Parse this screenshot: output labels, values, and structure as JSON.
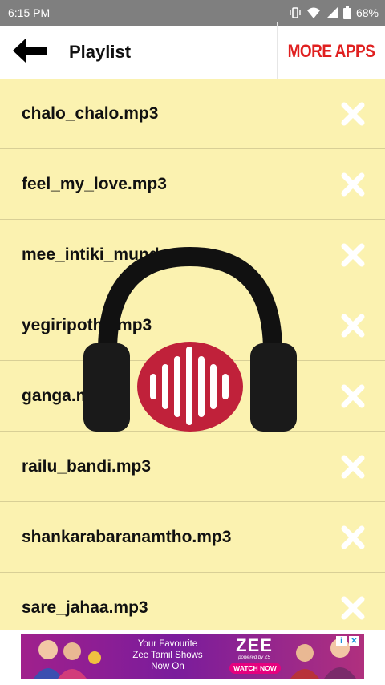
{
  "status_bar": {
    "time": "6:15 PM",
    "battery": "68%"
  },
  "app_bar": {
    "title": "Playlist",
    "more_apps_label": "MORE APPS"
  },
  "playlist": {
    "items": [
      {
        "label": "chalo_chalo.mp3"
      },
      {
        "label": "feel_my_love.mp3"
      },
      {
        "label": "mee_intiki_mundu.mp3"
      },
      {
        "label": "yegiripothe.mp3"
      },
      {
        "label": "ganga.mp3"
      },
      {
        "label": "railu_bandi.mp3"
      },
      {
        "label": "shankarabaranamtho.mp3"
      },
      {
        "label": "sare_jahaa.mp3"
      }
    ]
  },
  "ad": {
    "line1": "Your Favourite",
    "line2": "Zee Tamil Shows",
    "line3": "Now On",
    "brand": "ZEE",
    "brand_sub": "powered by Z5",
    "cta": "WATCH NOW"
  },
  "colors": {
    "status_bar": "#7f7f7f",
    "list_background": "#fbf2b0",
    "more_apps": "#e02020",
    "headphone_center": "#c0213a"
  },
  "icons": {
    "back": "arrow-left-icon",
    "remove": "close-icon",
    "overlay": "headphones-icon"
  }
}
